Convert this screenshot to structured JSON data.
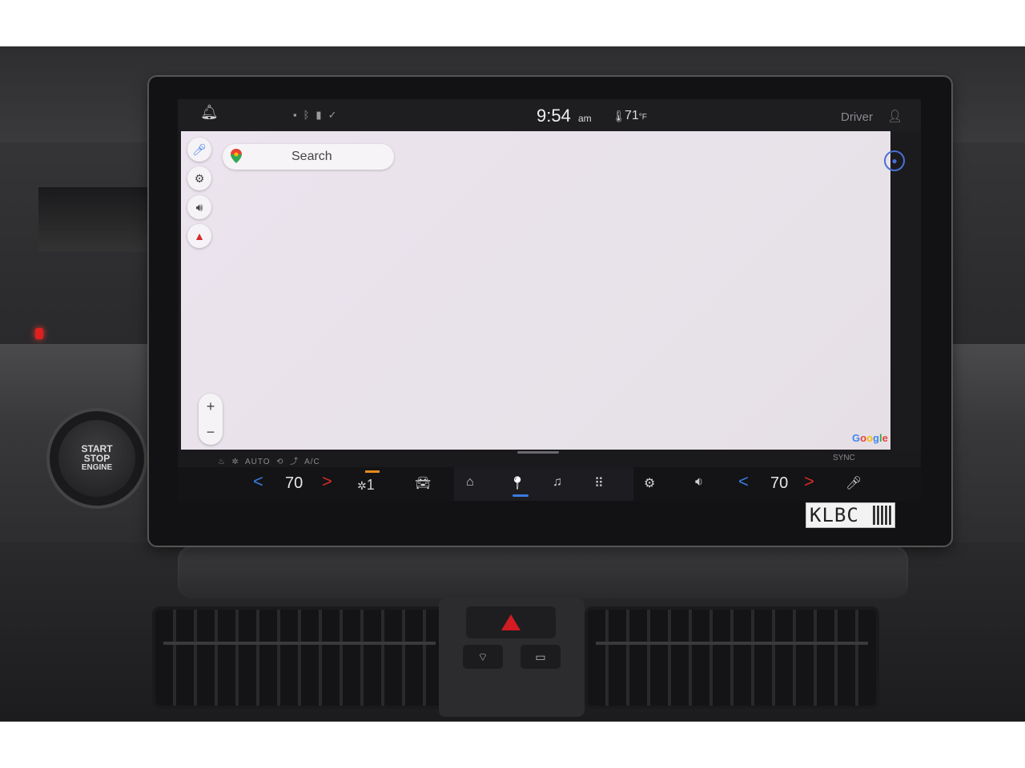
{
  "status_bar": {
    "bell_icon": "bell-icon",
    "time": "9:54",
    "ampm": "am",
    "outside_temp": "71",
    "temp_unit_glyph": "°F",
    "profile_label": "Driver"
  },
  "map": {
    "search_placeholder": "Search",
    "zoom_in_label": "+",
    "zoom_out_label": "−",
    "attribution": [
      "G",
      "o",
      "o",
      "g",
      "l",
      "e"
    ],
    "side_buttons": [
      "microphone-icon",
      "settings-icon",
      "volume-icon",
      "compass-icon"
    ]
  },
  "climate_strip": {
    "auto_label": "AUTO",
    "ac_label": "A/C",
    "sync_label": "SYNC"
  },
  "dock": {
    "driver_temp": "70",
    "fan_speed": "1",
    "passenger_temp": "70",
    "left_chevron": "<",
    "right_chevron": ">"
  },
  "vehicle": {
    "start_button": [
      "START",
      "STOP",
      "ENGINE"
    ],
    "sticker_text": "KLBC"
  },
  "colors": {
    "accent_blue": "#3a7be0",
    "accent_red": "#d42a2a",
    "fan_orange": "#e58a1e",
    "account_blue": "#4a6fd6"
  }
}
